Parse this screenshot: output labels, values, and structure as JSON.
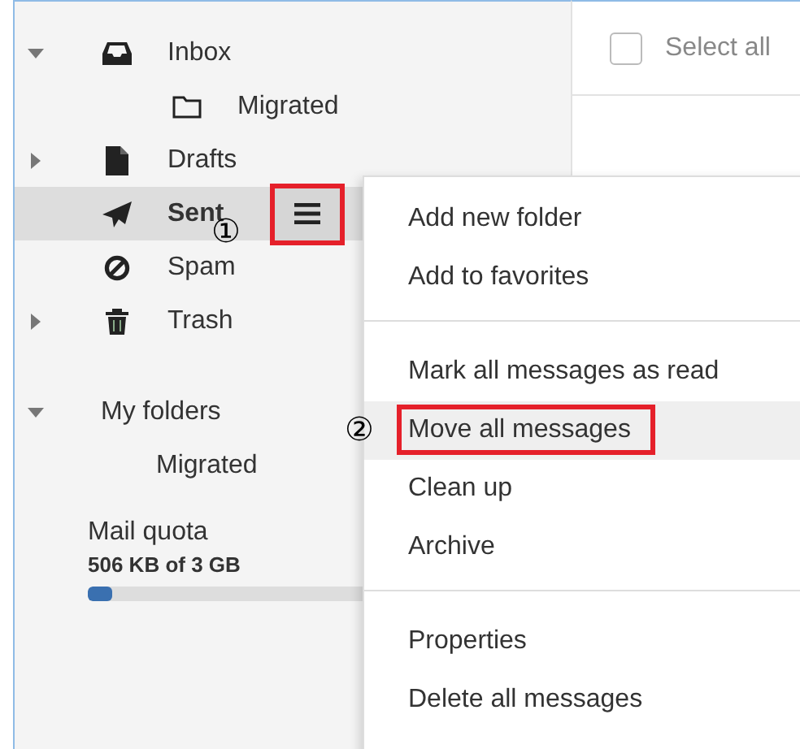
{
  "folders": [
    {
      "label": "Inbox",
      "kind": "inbox",
      "expandable": true,
      "expanded": true,
      "selected": false,
      "children": [
        {
          "label": "Migrated",
          "kind": "folder",
          "selected": false
        }
      ]
    },
    {
      "label": "Drafts",
      "kind": "drafts",
      "expandable": true,
      "expanded": false,
      "selected": false
    },
    {
      "label": "Sent",
      "kind": "sent",
      "expandable": false,
      "selected": true,
      "menu_button": {
        "highlighted": true,
        "callout": "①"
      }
    },
    {
      "label": "Spam",
      "kind": "spam",
      "expandable": false,
      "selected": false
    },
    {
      "label": "Trash",
      "kind": "trash",
      "expandable": true,
      "expanded": false,
      "selected": false
    }
  ],
  "my_folders": {
    "label": "My folders",
    "expanded": true,
    "children": [
      {
        "label": "Migrated",
        "selected": false
      }
    ]
  },
  "quota": {
    "label": "Mail quota",
    "usage": "506 KB of 3 GB",
    "level": 0.05
  },
  "header": {
    "select_all": {
      "label": "Select all",
      "checked": false
    }
  },
  "context_menu": {
    "groups": [
      [
        {
          "label": "Add new folder",
          "selected": false,
          "highlighted": false
        },
        {
          "label": "Add to favorites",
          "selected": false,
          "highlighted": false
        }
      ],
      [
        {
          "label": "Mark all messages as read",
          "selected": false,
          "highlighted": false
        },
        {
          "label": "Move all messages",
          "selected": true,
          "highlighted": true,
          "callout": "②"
        },
        {
          "label": "Clean up",
          "selected": false,
          "highlighted": false
        },
        {
          "label": "Archive",
          "selected": false,
          "highlighted": false
        }
      ],
      [
        {
          "label": "Properties",
          "selected": false,
          "highlighted": false
        },
        {
          "label": "Delete all messages",
          "selected": false,
          "highlighted": false
        }
      ]
    ]
  }
}
